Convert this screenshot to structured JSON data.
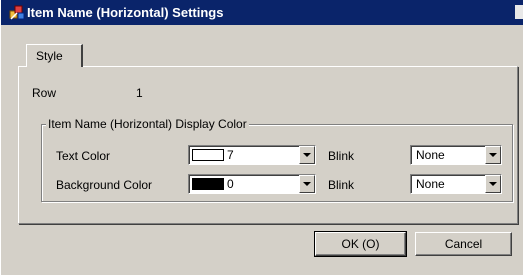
{
  "window": {
    "title": "Item Name (Horizontal) Settings"
  },
  "tabs": [
    {
      "label": "Style"
    }
  ],
  "row": {
    "label": "Row",
    "value": "1"
  },
  "group": {
    "title": "Item Name (Horizontal) Display Color",
    "text_color": {
      "label": "Text Color",
      "swatch": "#ffffff",
      "value": "7",
      "blink_label": "Blink",
      "blink_value": "None"
    },
    "background_color": {
      "label": "Background Color",
      "swatch": "#000000",
      "value": "0",
      "blink_label": "Blink",
      "blink_value": "None"
    }
  },
  "buttons": {
    "ok": "OK (O)",
    "cancel": "Cancel"
  }
}
